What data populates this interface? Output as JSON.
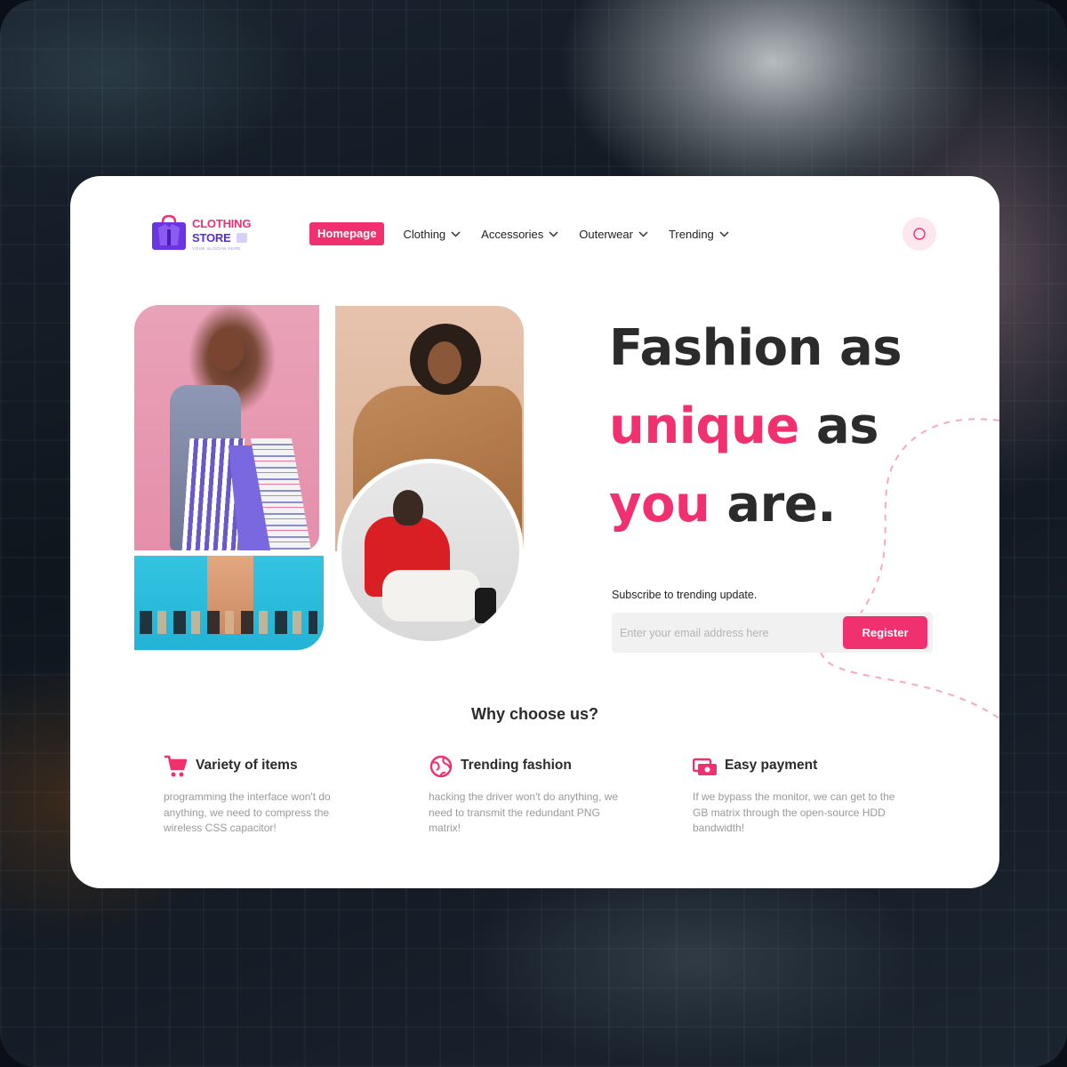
{
  "logo": {
    "line1": "CLOTHING",
    "line2": "STORE",
    "slogan": "YOUR SLOGAN HERE"
  },
  "nav": {
    "items": [
      {
        "label": "Homepage"
      },
      {
        "label": "Clothing"
      },
      {
        "label": "Accessories"
      },
      {
        "label": "Outerwear"
      },
      {
        "label": "Trending"
      }
    ]
  },
  "hero": {
    "line1": "Fashion as",
    "line2_accent": "unique",
    "line2_rest": " as",
    "line3_accent": "you",
    "line3_rest": " are."
  },
  "subscribe": {
    "label": "Subscribe to trending update.",
    "placeholder": "Enter your email address here",
    "button": "Register"
  },
  "why": {
    "title": "Why choose us?",
    "features": [
      {
        "icon": "cart-icon",
        "title": "Variety of items",
        "desc": "programming the interface won't do anything, we need to compress the wireless CSS capacitor!"
      },
      {
        "icon": "globe-icon",
        "title": "Trending fashion",
        "desc": "hacking the driver won't do anything, we need to transmit the redundant PNG matrix!"
      },
      {
        "icon": "cash-icon",
        "title": "Easy payment",
        "desc": "If we bypass the monitor, we can get to the GB matrix through the open-source HDD bandwidth!"
      }
    ]
  },
  "colors": {
    "accent": "#f0306f",
    "brand_purple": "#5b2bd6",
    "text": "#2b2b2b",
    "muted": "#9a9a9a"
  }
}
